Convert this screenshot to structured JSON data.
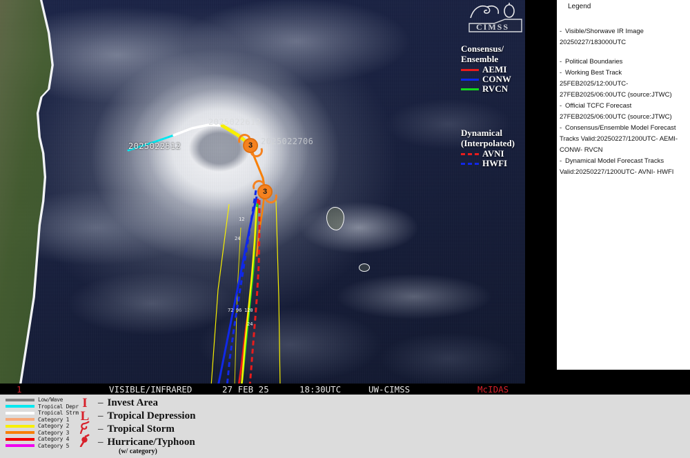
{
  "satellite": {
    "status_bar": {
      "number": "1",
      "mode": "VISIBLE/INFRARED",
      "date": "27 FEB 25",
      "time": "18:30UTC",
      "source": "UW-CIMSS",
      "system": "McIDAS"
    },
    "logo_text": "CIMSS",
    "track_labels": [
      {
        "id": "lbl-0225",
        "text": "2025022512"
      },
      {
        "id": "lbl-0226",
        "text": "2025022612"
      },
      {
        "id": "lbl-0227",
        "text": "2025022706"
      }
    ],
    "storm_symbols": [
      {
        "category": "3"
      },
      {
        "category": "3"
      }
    ]
  },
  "consensus_legend": {
    "title_line1": "Consensus/",
    "title_line2": "Ensemble",
    "items": [
      {
        "name": "AEMI",
        "color": "#e81c1c",
        "style": "solid"
      },
      {
        "name": "CONW",
        "color": "#1028e8",
        "style": "solid"
      },
      {
        "name": "RVCN",
        "color": "#14d81c",
        "style": "solid"
      }
    ]
  },
  "dynamical_legend": {
    "title_line1": "Dynamical",
    "title_line2": "(Interpolated)",
    "items": [
      {
        "name": "AVNI",
        "color": "#e81c1c",
        "style": "dash"
      },
      {
        "name": "HWFI",
        "color": "#1028e8",
        "style": "dash"
      }
    ]
  },
  "sidebar": {
    "heading": "Legend",
    "entries": [
      {
        "bullet": "-",
        "text": "Visible/Shorwave IR Image",
        "continuation": "20250227/183000UTC",
        "gap_after": true
      },
      {
        "bullet": "-",
        "text": "Political Boundaries",
        "continuation": "",
        "gap_after": false
      },
      {
        "bullet": "-",
        "text": "Working Best Track",
        "continuation": "25FEB2025/12:00UTC-",
        "continuation2": "27FEB2025/06:00UTC   (source:JTWC)",
        "gap_after": false
      },
      {
        "bullet": "-",
        "text": "Official TCFC Forecast",
        "continuation": "27FEB2025/06:00UTC  (source:JTWC)",
        "gap_after": false
      },
      {
        "bullet": "-",
        "text": "Consensus/Ensemble Model Forecast",
        "continuation": "Tracks  Valid:20250227/1200UTC- AEMI-",
        "continuation2": "CONW- RVCN",
        "gap_after": false
      },
      {
        "bullet": "-",
        "text": "Dynamical Model Forecast Tracks",
        "continuation": "Valid:20250227/1200UTC- AVNI- HWFI",
        "gap_after": false
      }
    ]
  },
  "intensity_scale": [
    {
      "label": "Low/Wave",
      "color": "#808080"
    },
    {
      "label": "Tropical Depr",
      "color": "#00e8f0"
    },
    {
      "label": "Tropical Strm",
      "color": "#ffffff"
    },
    {
      "label": "Category 1",
      "color": "#f8a878"
    },
    {
      "label": "Category 2",
      "color": "#f8f000"
    },
    {
      "label": "Category 3",
      "color": "#f88008"
    },
    {
      "label": "Category 4",
      "color": "#f00000"
    },
    {
      "label": "Category 5",
      "color": "#f000f0"
    }
  ],
  "symbol_legend": [
    {
      "glyph": "I",
      "dash": "–",
      "label": "Invest Area"
    },
    {
      "glyph": "L",
      "dash": "–",
      "label": "Tropical Depression"
    },
    {
      "glyph": "cyclone-open",
      "dash": "–",
      "label": "Tropical Storm"
    },
    {
      "glyph": "cyclone-filled",
      "dash": "–",
      "label": "Hurricane/Typhoon"
    }
  ],
  "symbol_sublabel": "(w/ category)"
}
